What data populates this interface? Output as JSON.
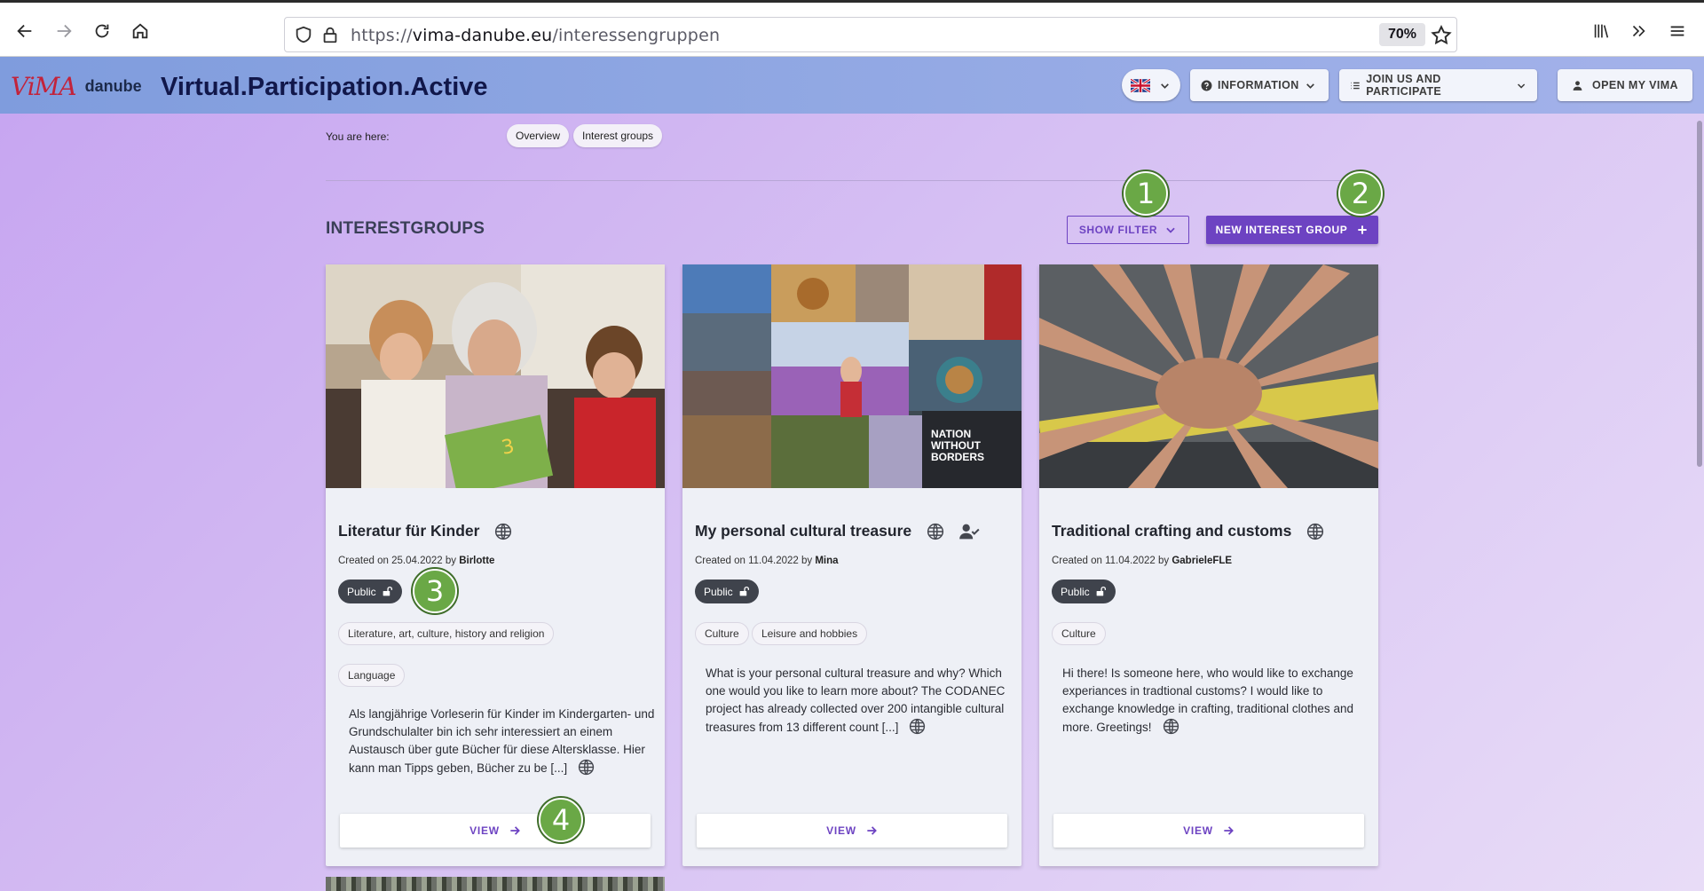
{
  "browser": {
    "url_prefix": "https://",
    "url_domain": "vima-danube.eu",
    "url_path": "/interessengruppen",
    "zoom": "70%"
  },
  "header": {
    "logo_vima": "ViMA",
    "logo_danube": "danube",
    "title": "Virtual.Participation.Active",
    "information_label": "INFORMATION",
    "join_label": "JOIN US AND PARTICIPATE",
    "open_label": "OPEN MY VIMA"
  },
  "breadcrumb": {
    "label": "You are here:",
    "items": [
      "Overview",
      "Interest groups"
    ]
  },
  "section": {
    "title": "INTERESTGROUPS",
    "filter_label": "SHOW FILTER",
    "new_label": "NEW INTEREST GROUP"
  },
  "callouts": [
    "1",
    "2",
    "3",
    "4"
  ],
  "cards": [
    {
      "title": "Literatur für Kinder",
      "created_prefix": "Created on 25.04.2022 by ",
      "author": "Birlotte",
      "visibility": "Public",
      "tags": [
        "Literature, art, culture, history and religion",
        "Language"
      ],
      "description": "Als langjährige Vorleserin für Kinder im Kindergarten- und Grundschulalter bin ich sehr interessiert an einem Austausch über gute Bücher für diese Altersklasse. Hier kann man Tipps geben, Bücher zu be [...]",
      "view_label": "VIEW"
    },
    {
      "title": "My personal cultural treasure",
      "created_prefix": "Created on 11.04.2022 by ",
      "author": "Mina",
      "visibility": "Public",
      "tags": [
        "Culture",
        "Leisure and hobbies"
      ],
      "description": "What is your personal cultural treasure and why? Which one would you like to learn more about?  The CODANEC project has already collected over 200 intangible cultural treasures from 13 different count [...]",
      "image_caption": "NATION WITHOUT BORDERS",
      "view_label": "VIEW"
    },
    {
      "title": "Traditional crafting and customs",
      "created_prefix": "Created on 11.04.2022 by ",
      "author": "GabrieleFLE",
      "visibility": "Public",
      "tags": [
        "Culture"
      ],
      "description": "Hi there! Is someone here, who would like to exchange experiances in tradtional customs? I would like to exchange knowledge in crafting, traditional clothes and more. Greetings!",
      "view_label": "VIEW"
    }
  ],
  "icons": {
    "back": "arrow-left-icon",
    "forward": "arrow-right-icon",
    "reload": "reload-icon",
    "home": "home-icon",
    "shield": "shield-icon",
    "lock": "lock-icon",
    "star": "star-icon",
    "library": "library-icon",
    "overflow": "chevrons-right-icon",
    "menu": "hamburger-icon",
    "globe": "globe-icon",
    "unlock": "unlock-icon",
    "user_check": "user-check-icon",
    "arrow": "arrow-right-icon",
    "plus": "plus-icon"
  },
  "colors": {
    "accent": "#6d43c2",
    "callout": "#6aa846",
    "badge_dark": "#3f434c"
  }
}
